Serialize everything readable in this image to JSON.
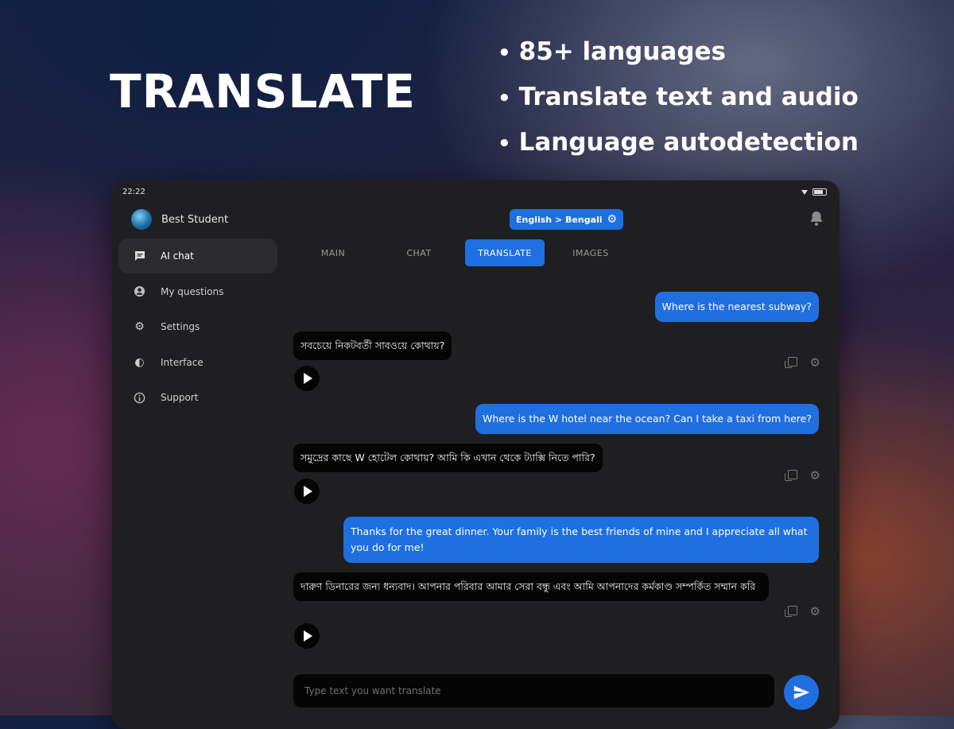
{
  "promo": {
    "title": "TRANSLATE",
    "features": [
      "85+ languages",
      "Translate text and audio",
      "Language autodetection"
    ]
  },
  "status_bar": {
    "time": "22:22"
  },
  "profile": {
    "name": "Best Student"
  },
  "sidebar": {
    "items": [
      {
        "label": "AI chat",
        "icon": "chat-icon",
        "active": true
      },
      {
        "label": "My questions",
        "icon": "user-circle-icon"
      },
      {
        "label": "Settings",
        "icon": "gear-icon"
      },
      {
        "label": "Interface",
        "icon": "contrast-icon"
      },
      {
        "label": "Support",
        "icon": "info-icon"
      }
    ]
  },
  "language_selector": {
    "label": "English > Bengali"
  },
  "tabs": [
    {
      "label": "MAIN"
    },
    {
      "label": "CHAT"
    },
    {
      "label": "TRANSLATE",
      "active": true
    },
    {
      "label": "IMAGES"
    }
  ],
  "messages": [
    {
      "role": "user",
      "text": "Where is the nearest subway?"
    },
    {
      "role": "translation",
      "text": "সবচেয়ে নিকটবর্তী সাবওয়ে কোথায়?"
    },
    {
      "role": "user",
      "text": "Where is the W hotel near the ocean? Can I take a taxi from here?"
    },
    {
      "role": "translation",
      "text": "সমুদ্রের কাছে W হোটেল কোথায়? আমি কি এখান থেকে ট্যাক্সি নিতে পারি?"
    },
    {
      "role": "user",
      "text": "Thanks for the great dinner. Your family is the best friends of mine and I appreciate all what you do for me!"
    },
    {
      "role": "translation",
      "text": "দারুণ ডিনারের জন্য ধন্যবাদ। আপনার পরিবার আমার সেরা বন্ধু এবং আমি আপনাদের কর্মকাণ্ড সম্পর্কিত সম্মান করি"
    }
  ],
  "composer": {
    "placeholder": "Type text you want translate"
  },
  "colors": {
    "accent": "#1f6fe0",
    "panel": "#1f1f21",
    "bubble_dark": "#050505"
  }
}
